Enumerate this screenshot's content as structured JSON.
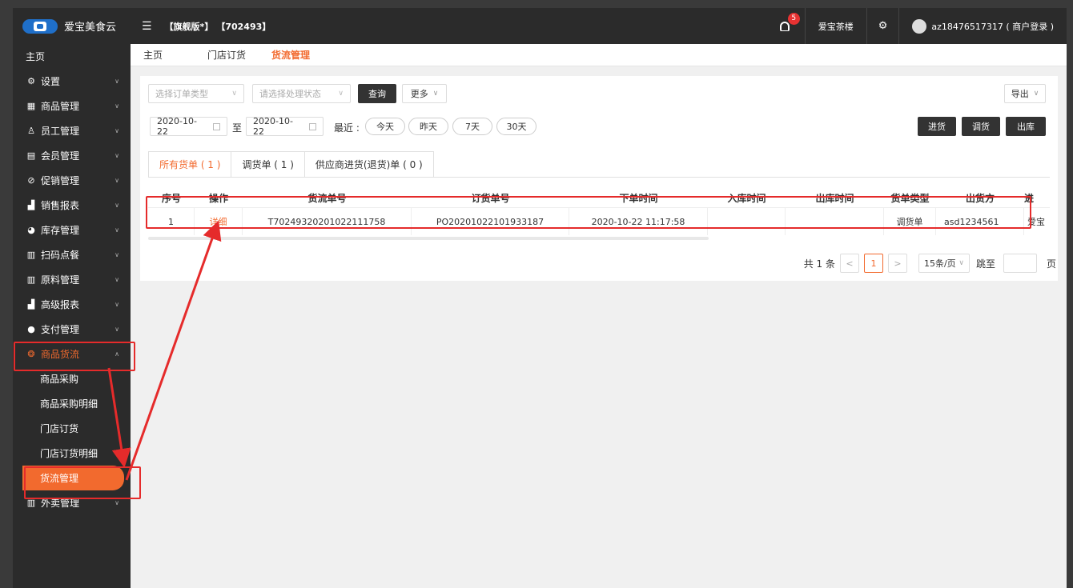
{
  "header": {
    "brand": "爱宝美食云",
    "edition": "【旗舰版*】",
    "store_id": "【702493】",
    "notifications": "5",
    "shop_name": "爱宝茶楼",
    "user": "az18476517317 ( 商户登录 )"
  },
  "sidebar": {
    "home": "主页",
    "items": [
      {
        "label": "设置",
        "icon": "⚙"
      },
      {
        "label": "商品管理",
        "icon": "▦"
      },
      {
        "label": "员工管理",
        "icon": "♙"
      },
      {
        "label": "会员管理",
        "icon": "▤"
      },
      {
        "label": "促销管理",
        "icon": "⊘"
      },
      {
        "label": "销售报表",
        "icon": "▟"
      },
      {
        "label": "库存管理",
        "icon": "◕"
      },
      {
        "label": "扫码点餐",
        "icon": "▥"
      },
      {
        "label": "原料管理",
        "icon": "▥"
      },
      {
        "label": "高级报表",
        "icon": "▟"
      },
      {
        "label": "支付管理",
        "icon": "●"
      },
      {
        "label": "商品货流",
        "icon": "❂"
      }
    ],
    "sub_items": [
      "商品采购",
      "商品采购明细",
      "门店订货",
      "门店订货明细",
      "货流管理"
    ],
    "last_item": {
      "label": "外卖管理",
      "icon": "▥"
    }
  },
  "tabs": [
    "主页",
    "门店订货",
    "货流管理"
  ],
  "filters": {
    "order_type_placeholder": "选择订单类型",
    "status_placeholder": "请选择处理状态",
    "query": "查询",
    "more": "更多",
    "export": "导出",
    "date_from": "2020-10-22",
    "to": "至",
    "date_to": "2020-10-22",
    "recent": "最近 :",
    "quick": [
      "今天",
      "昨天",
      "7天",
      "30天"
    ],
    "actions": [
      "进货",
      "调货",
      "出库"
    ]
  },
  "subtabs": [
    "所有货单 ( 1 )",
    "调货单 ( 1 )",
    "供应商进货(退货)单 ( 0 )"
  ],
  "table": {
    "headers": [
      "序号",
      "操作",
      "货流单号",
      "订货单号",
      "下单时间",
      "入库时间",
      "出库时间",
      "货单类型",
      "出货方",
      "进"
    ],
    "rows": [
      [
        "1",
        "详细",
        "T70249320201022111758",
        "PO20201022101933187",
        "2020-10-22 11:17:58",
        "",
        "",
        "调货单",
        "asd1234561",
        "爱宝"
      ]
    ]
  },
  "pagination": {
    "total": "共 1 条",
    "prev": "<",
    "current": "1",
    "next": ">",
    "page_size": "15条/页",
    "jump": "跳至",
    "unit": "页"
  },
  "colors": {
    "accent": "#f26a2e",
    "sidebar_bg": "#2b2b2b",
    "annotation": "#e52b2b"
  }
}
